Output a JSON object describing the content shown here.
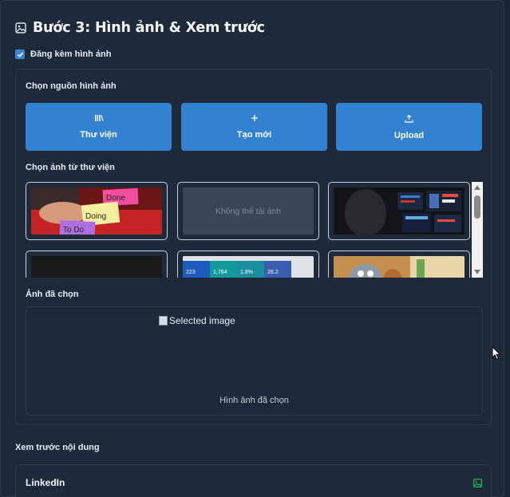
{
  "header": {
    "title": "Bước 3: Hình ảnh & Xem trước",
    "icon": "image-icon"
  },
  "attach": {
    "label": "Đăng kèm hình ảnh",
    "checked": true
  },
  "source": {
    "label": "Chọn nguồn hình ảnh",
    "buttons": [
      {
        "label": "Thư viện",
        "icon": "library-icon"
      },
      {
        "label": "Tạo mới",
        "icon": "plus-icon"
      },
      {
        "label": "Upload",
        "icon": "upload-icon"
      }
    ],
    "accent": "#3381d1"
  },
  "gallery": {
    "label": "Chọn ảnh từ thư viện",
    "failed_text": "Không thể tải ảnh",
    "sticky_notes": [
      "Done",
      "Doing",
      "To Do"
    ],
    "dashboard_values": [
      "223",
      "1,764",
      "1.8%",
      "26.2"
    ]
  },
  "selected": {
    "label": "Ảnh đã chọn",
    "alt_text": "Selected image",
    "caption": "Hình ảnh đã chọn"
  },
  "preview": {
    "label": "Xem trước nội dung",
    "platform": "LinkedIn"
  },
  "colors": {
    "background": "#1e2a3a",
    "accent": "#3381d1",
    "success": "#22c55e"
  }
}
